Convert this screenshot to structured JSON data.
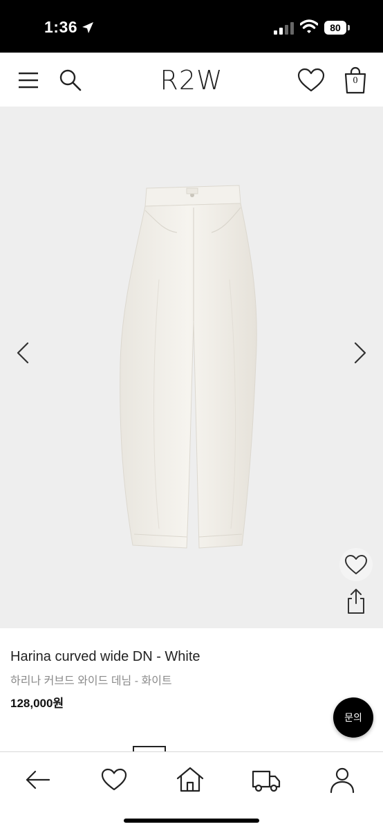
{
  "status_bar": {
    "time": "1:36",
    "battery": "80"
  },
  "header": {
    "logo": "R2W",
    "cart_count": "0"
  },
  "product": {
    "name": "Harina curved wide DN - White",
    "name_kr": "하리나 커브드 와이드 데님 - 화이트",
    "price": "128,000원"
  },
  "floating": {
    "inquiry_label": "문의"
  },
  "icons": {
    "header": [
      "menu-icon",
      "search-icon",
      "heart-icon",
      "shopping-bag-icon"
    ],
    "gallery": [
      "chevron-left-icon",
      "chevron-right-icon",
      "heart-icon",
      "share-icon"
    ],
    "tabbar": [
      "back-arrow-icon",
      "heart-icon",
      "home-icon",
      "delivery-truck-icon",
      "user-icon"
    ]
  },
  "colors": {
    "status_bar": "#000000",
    "gallery_bg": "#eeeeee",
    "price_text": "#111111",
    "subtitle_text": "#8a8a8a",
    "inquiry_bg": "#000000"
  }
}
